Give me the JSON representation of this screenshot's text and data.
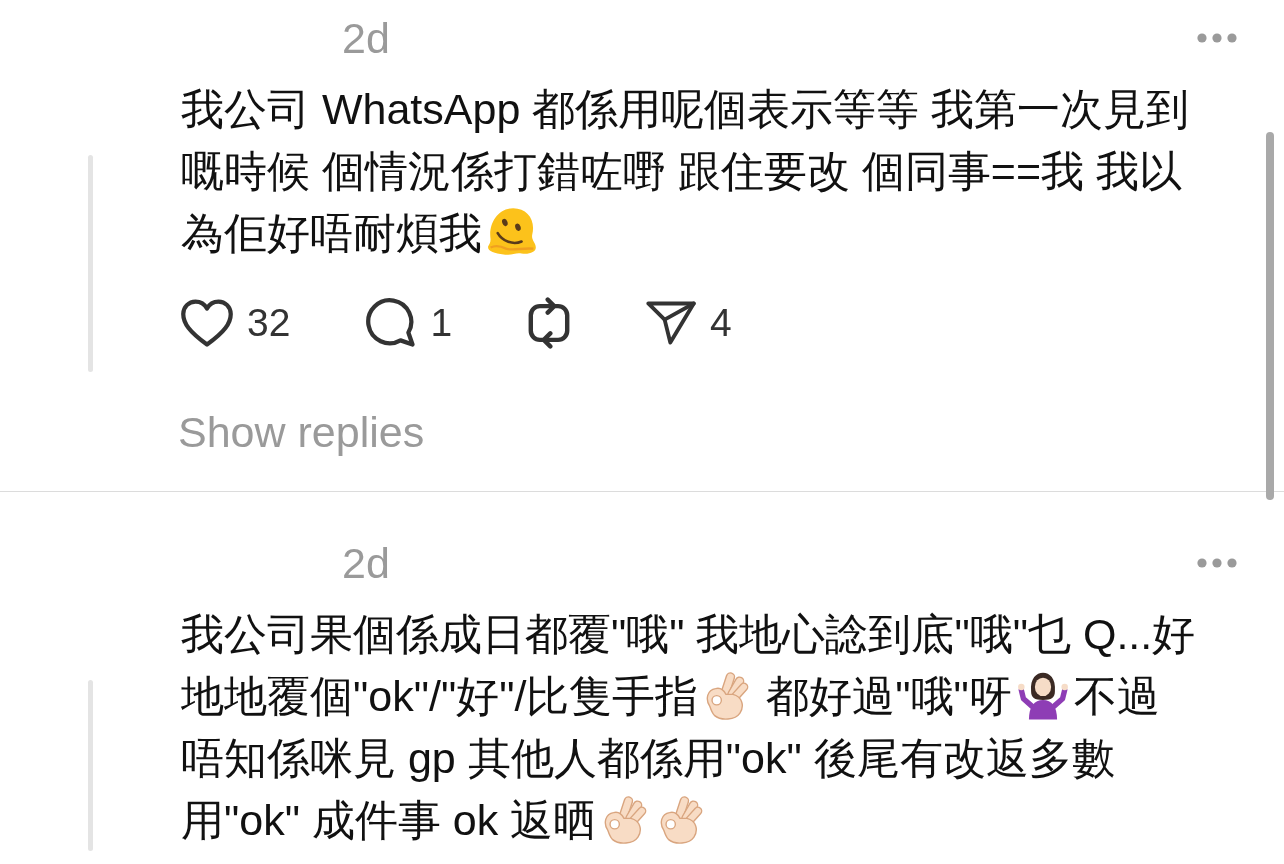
{
  "comments": [
    {
      "timestamp": "2d",
      "lines": [
        [
          {
            "kind": "text",
            "text": "我公司 WhatsApp 都係用呢個表示等等 我第一次見到"
          }
        ],
        [
          {
            "kind": "text",
            "text": "嘅時候 個情況係打錯咗嘢 跟住要改 個同事==我 我以"
          }
        ],
        [
          {
            "kind": "text",
            "text": "為佢好唔耐煩我"
          },
          {
            "kind": "melting"
          }
        ]
      ],
      "actions": [
        {
          "kind": "like",
          "count": "32"
        },
        {
          "kind": "reply",
          "count": "1"
        },
        {
          "kind": "repost"
        },
        {
          "kind": "share",
          "count": "4"
        }
      ],
      "replies_link": "Show replies"
    },
    {
      "timestamp": "2d",
      "lines": [
        [
          {
            "kind": "text",
            "text": "我公司果個係成日都覆\"哦\" 我地心諗到底\"哦\"乜 Q...好"
          }
        ],
        [
          {
            "kind": "text",
            "text": "地地覆個\"ok\"/\"好\"/比隻手指"
          },
          {
            "kind": "okhand"
          },
          {
            "kind": "text",
            "text": " 都好過\"哦\"呀"
          },
          {
            "kind": "shrug"
          },
          {
            "kind": "text",
            "text": "不過"
          }
        ],
        [
          {
            "kind": "text",
            "text": "唔知係咪見 gp 其他人都係用\"ok\" 後尾有改返多數"
          }
        ],
        [
          {
            "kind": "text",
            "text": "用\"ok\" 成件事 ok 返晒"
          },
          {
            "kind": "okhand"
          },
          {
            "kind": "okhand"
          }
        ]
      ]
    }
  ]
}
